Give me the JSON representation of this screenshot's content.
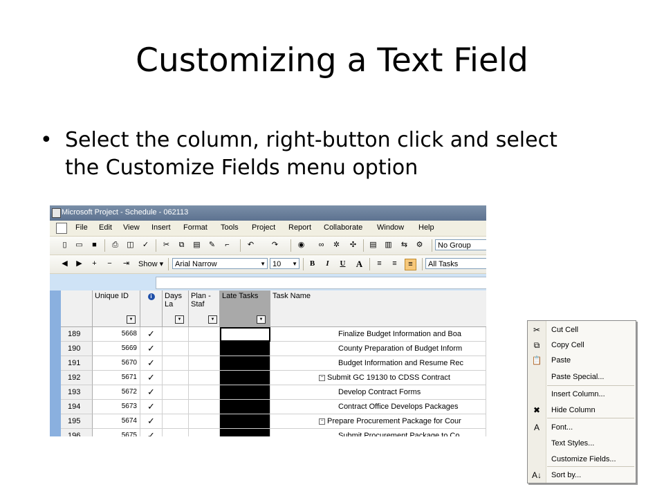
{
  "slide": {
    "title": "Customizing a Text Field",
    "bullet": "Select the column, right-button click and select the Customize Fields menu option"
  },
  "window": {
    "title": "Microsoft Project - Schedule - 062113"
  },
  "menu": [
    "File",
    "Edit",
    "View",
    "Insert",
    "Format",
    "Tools",
    "Project",
    "Report",
    "Collaborate",
    "Window",
    "Help"
  ],
  "toolbar": {
    "group_value": "No Group",
    "show_label": "Show",
    "font_value": "Arial Narrow",
    "size_value": "10",
    "filter_value": "All Tasks",
    "bold": "B",
    "italic": "I",
    "underline": "U",
    "font_color": "A"
  },
  "columns": {
    "unique_id": "Unique ID",
    "info": "i",
    "days_late": "Days La",
    "plan": "Plan - Staf",
    "late_tasks": "Late Tasks",
    "task_name": "Task Name"
  },
  "rows": [
    {
      "id": "189",
      "uid": "5668",
      "check": "✓",
      "name": "Finalize Budget Information and Boa",
      "summary": false
    },
    {
      "id": "190",
      "uid": "5669",
      "check": "✓",
      "name": "County Preparation of Budget Inform",
      "summary": false
    },
    {
      "id": "191",
      "uid": "5670",
      "check": "✓",
      "name": "Budget Information and Resume Rec",
      "summary": false
    },
    {
      "id": "192",
      "uid": "5671",
      "check": "✓",
      "name": "Submit GC 19130 to CDSS Contract",
      "summary": true
    },
    {
      "id": "193",
      "uid": "5672",
      "check": "✓",
      "name": "Develop Contract Forms",
      "summary": false
    },
    {
      "id": "194",
      "uid": "5673",
      "check": "✓",
      "name": "Contract Office Develops Packages",
      "summary": false
    },
    {
      "id": "195",
      "uid": "5674",
      "check": "✓",
      "name": "Prepare Procurement Package for Cour",
      "summary": true
    },
    {
      "id": "196",
      "uid": "5675",
      "check": "✓",
      "name": "Submit Procurement Package to Co",
      "summary": false
    }
  ],
  "context_menu": [
    {
      "label": "Cut Cell",
      "icon": "scissors-icon",
      "glyph": "✂"
    },
    {
      "label": "Copy Cell",
      "icon": "copy-icon",
      "glyph": "⧉"
    },
    {
      "label": "Paste",
      "icon": "paste-icon",
      "glyph": "📋"
    },
    {
      "label": "Paste Special...",
      "icon": "",
      "glyph": ""
    },
    {
      "label": "Insert Column...",
      "icon": "",
      "glyph": ""
    },
    {
      "label": "Hide Column",
      "icon": "hide-column-icon",
      "glyph": "✖"
    },
    {
      "label": "Font...",
      "icon": "font-icon",
      "glyph": "A"
    },
    {
      "label": "Text Styles...",
      "icon": "",
      "glyph": ""
    },
    {
      "label": "Customize Fields...",
      "icon": "",
      "glyph": ""
    },
    {
      "label": "Sort by...",
      "icon": "sort-icon",
      "glyph": "A↓"
    }
  ]
}
